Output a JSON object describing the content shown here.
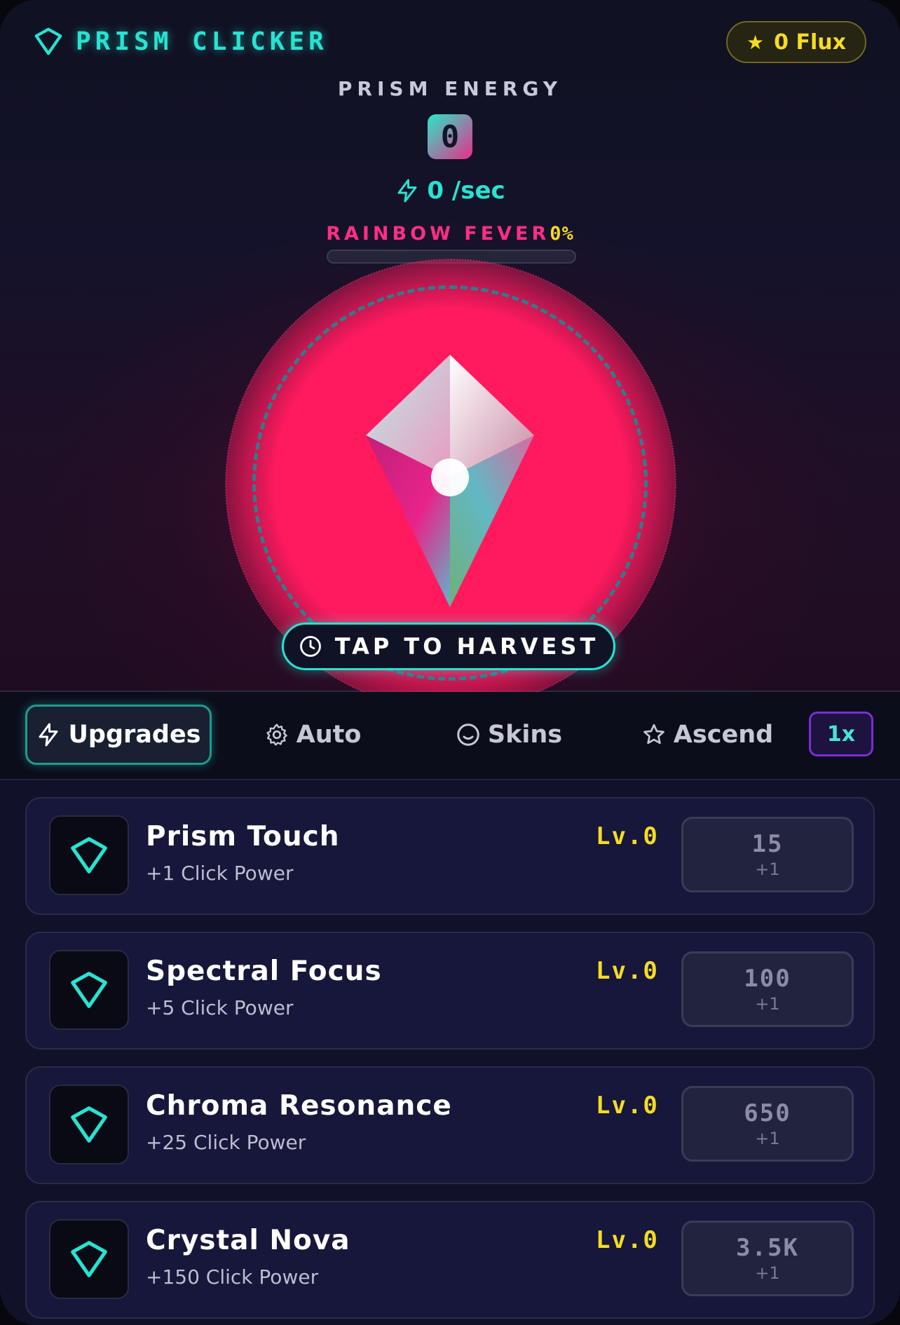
{
  "header": {
    "title": "PRISM CLICKER",
    "flux": "0 Flux"
  },
  "energy": {
    "label": "PRISM ENERGY",
    "value": "0",
    "rate": "0 /sec"
  },
  "fever": {
    "label": "RAINBOW FEVER",
    "percent_text": "0%",
    "progress": 0
  },
  "harvest": {
    "label": "TAP TO HARVEST"
  },
  "tabs": [
    {
      "label": "Upgrades",
      "icon": "lightning-icon",
      "active": true
    },
    {
      "label": "Auto",
      "icon": "gear-icon",
      "active": false
    },
    {
      "label": "Skins",
      "icon": "smile-icon",
      "active": false
    },
    {
      "label": "Ascend",
      "icon": "star-icon",
      "active": false
    }
  ],
  "multiplier": "1x",
  "upgrades": [
    {
      "name": "Prism Touch",
      "desc": "+1 Click Power",
      "level": "Lv.0",
      "cost": "15",
      "gain": "+1"
    },
    {
      "name": "Spectral Focus",
      "desc": "+5 Click Power",
      "level": "Lv.0",
      "cost": "100",
      "gain": "+1"
    },
    {
      "name": "Chroma Resonance",
      "desc": "+25 Click Power",
      "level": "Lv.0",
      "cost": "650",
      "gain": "+1"
    },
    {
      "name": "Crystal Nova",
      "desc": "+150 Click Power",
      "level": "Lv.0",
      "cost": "3.5K",
      "gain": "+1"
    }
  ],
  "colors": {
    "accent": "#27e3d1",
    "pink": "#ff2e86",
    "gold": "#f5dc24",
    "orb": "#ff1a5e",
    "purple": "#7a2dd6"
  }
}
